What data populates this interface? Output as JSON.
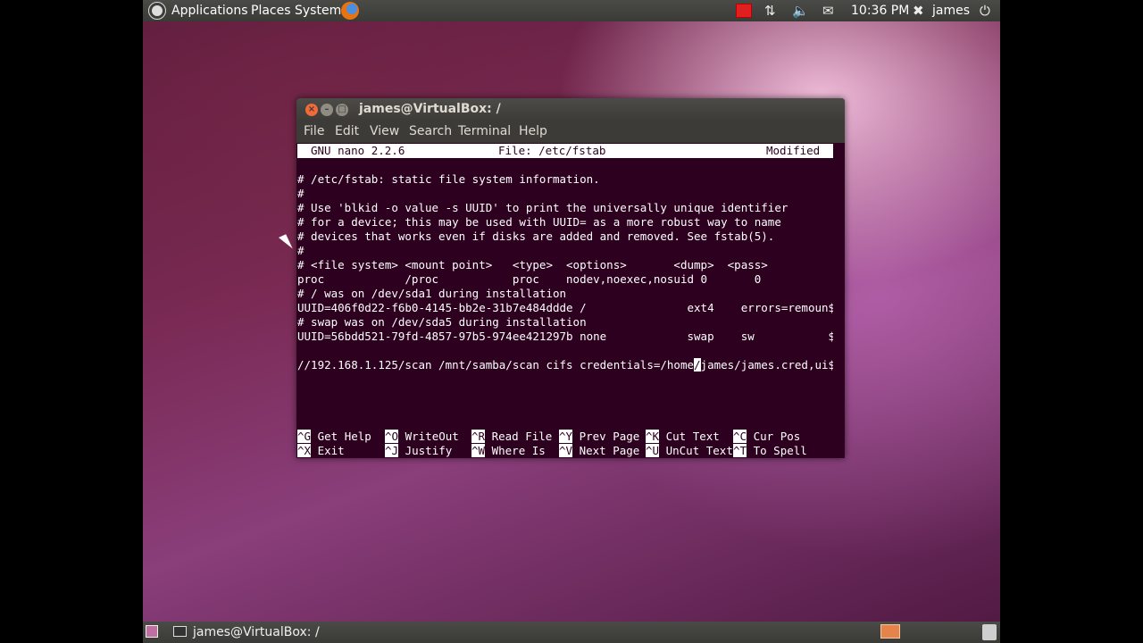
{
  "top_panel": {
    "menus": [
      "Applications",
      "Places",
      "System"
    ],
    "clock": "10:36 PM",
    "user": "james"
  },
  "terminal": {
    "title": "james@VirtualBox: /",
    "menu": [
      "File",
      "Edit",
      "View",
      "Search",
      "Terminal",
      "Help"
    ]
  },
  "nano": {
    "version": "GNU nano 2.2.6",
    "file": "File: /etc/fstab",
    "status": "Modified",
    "lines": [
      "# /etc/fstab: static file system information.",
      "#",
      "# Use 'blkid -o value -s UUID' to print the universally unique identifier",
      "# for a device; this may be used with UUID= as a more robust way to name",
      "# devices that works even if disks are added and removed. See fstab(5).",
      "#",
      "# <file system> <mount point>   <type>  <options>       <dump>  <pass>",
      "proc            /proc           proc    nodev,noexec,nosuid 0       0",
      "# / was on /dev/sda1 during installation",
      "UUID=406f0d22-f6b0-4145-bb2e-31b7e484ddde /               ext4    errors=remoun$",
      "# swap was on /dev/sda5 during installation",
      "UUID=56bdd521-79fd-4857-97b5-974ee421297b none            swap    sw           $",
      ""
    ],
    "edit_line_before": "//192.168.1.125/scan /mnt/samba/scan cifs credentials=/home",
    "edit_cursor_char": "/",
    "edit_line_after": "james/james.cred,ui$",
    "shortcuts_row1": [
      {
        "key": "^G",
        "label": " Get Help "
      },
      {
        "key": "^O",
        "label": " WriteOut "
      },
      {
        "key": "^R",
        "label": " Read File"
      },
      {
        "key": "^Y",
        "label": " Prev Page"
      },
      {
        "key": "^K",
        "label": " Cut Text "
      },
      {
        "key": "^C",
        "label": " Cur Pos"
      }
    ],
    "shortcuts_row2": [
      {
        "key": "^X",
        "label": " Exit     "
      },
      {
        "key": "^J",
        "label": " Justify  "
      },
      {
        "key": "^W",
        "label": " Where Is "
      },
      {
        "key": "^V",
        "label": " Next Page"
      },
      {
        "key": "^U",
        "label": " UnCut Text"
      },
      {
        "key": "^T",
        "label": " To Spell"
      }
    ]
  },
  "bottom_panel": {
    "task": "james@VirtualBox: /"
  }
}
